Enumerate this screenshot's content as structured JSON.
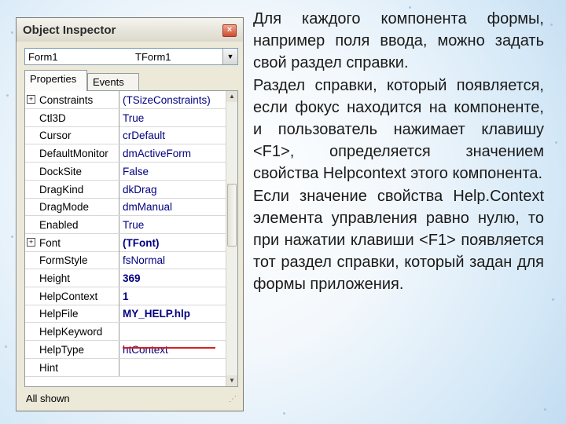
{
  "inspector": {
    "title": "Object Inspector",
    "close_glyph": "×",
    "component_name": "Form1",
    "component_class": "TForm1",
    "tabs": [
      "Properties",
      "Events"
    ],
    "active_tab": "Properties",
    "properties": [
      {
        "name": "Constraints",
        "value": "(TSizeConstraints)",
        "expandable": true,
        "bold": false
      },
      {
        "name": "Ctl3D",
        "value": "True",
        "expandable": false,
        "bold": false
      },
      {
        "name": "Cursor",
        "value": "crDefault",
        "expandable": false,
        "bold": false
      },
      {
        "name": "DefaultMonitor",
        "value": "dmActiveForm",
        "expandable": false,
        "bold": false
      },
      {
        "name": "DockSite",
        "value": "False",
        "expandable": false,
        "bold": false
      },
      {
        "name": "DragKind",
        "value": "dkDrag",
        "expandable": false,
        "bold": false
      },
      {
        "name": "DragMode",
        "value": "dmManual",
        "expandable": false,
        "bold": false
      },
      {
        "name": "Enabled",
        "value": "True",
        "expandable": false,
        "bold": false
      },
      {
        "name": "Font",
        "value": "(TFont)",
        "expandable": true,
        "bold": true
      },
      {
        "name": "FormStyle",
        "value": "fsNormal",
        "expandable": false,
        "bold": false
      },
      {
        "name": "Height",
        "value": "369",
        "expandable": false,
        "bold": true
      },
      {
        "name": "HelpContext",
        "value": "1",
        "expandable": false,
        "bold": true
      },
      {
        "name": "HelpFile",
        "value": "MY_HELP.hlp",
        "expandable": false,
        "bold": true
      },
      {
        "name": "HelpKeyword",
        "value": "",
        "expandable": false,
        "bold": false
      },
      {
        "name": "HelpType",
        "value": "htContext",
        "expandable": false,
        "bold": false
      },
      {
        "name": "Hint",
        "value": "",
        "expandable": false,
        "bold": false
      }
    ],
    "status": "All shown",
    "expand_glyph": "+"
  },
  "text_paragraphs": [
    "Для каждого компонента формы, например поля ввода, можно задать свой раздел справки.",
    "Раздел справки, который появляется, если фокус находится на компоненте, и пользователь нажимает клавишу <F1>, определяется значением свойства Helpcontext этого компонента.",
    "Если значение свойства Help.Context элемента управления равно нулю, то при нажатии клавиши <F1> появляется тот раздел справки, который задан для формы приложения."
  ],
  "colors": {
    "property_value": "#000080",
    "underline_accent": "#d61f1f",
    "background_edge": "#c2dcf1"
  }
}
